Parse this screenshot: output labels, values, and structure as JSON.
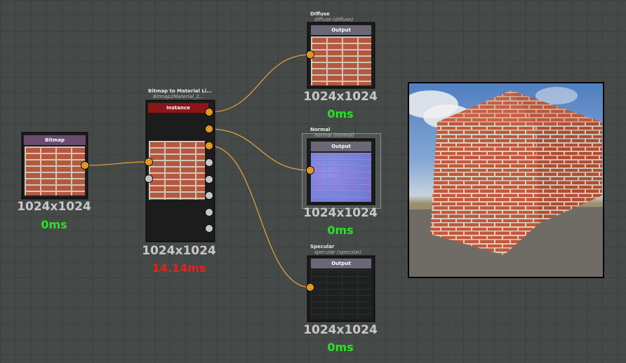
{
  "colors": {
    "canvas": "#454a49",
    "wire": "#e8a43a",
    "port_active": "#f0a526",
    "port_inactive": "#c6c6c6",
    "time_ok": "#27e320",
    "time_slow": "#e8201c",
    "bitmap_header": "#6a4a6e",
    "instance_header": "#8e1418",
    "output_header": "#6b6777"
  },
  "nodes": {
    "bitmap": {
      "header": "Bitmap",
      "resolution": "1024x1024",
      "time": "0ms"
    },
    "material": {
      "title": "Bitmap to Material Li...",
      "subtitle": "Bitmap2Material_2...",
      "header": "Instance",
      "resolution": "1024x1024",
      "time": "14.14ms"
    },
    "diffuse": {
      "title": "Diffuse",
      "subtitle": "diffuse (diffuse)",
      "header": "Output",
      "resolution": "1024x1024",
      "time": "0ms"
    },
    "normal": {
      "title": "Normal",
      "subtitle": "normal (normal)",
      "header": "Output",
      "resolution": "1024x1024",
      "time": "0ms"
    },
    "specular": {
      "title": "Specular",
      "subtitle": "specular (specular)",
      "header": "Output",
      "resolution": "1024x1024",
      "time": "0ms"
    }
  },
  "preview": {
    "icon": "brick-cube-3d-preview"
  }
}
